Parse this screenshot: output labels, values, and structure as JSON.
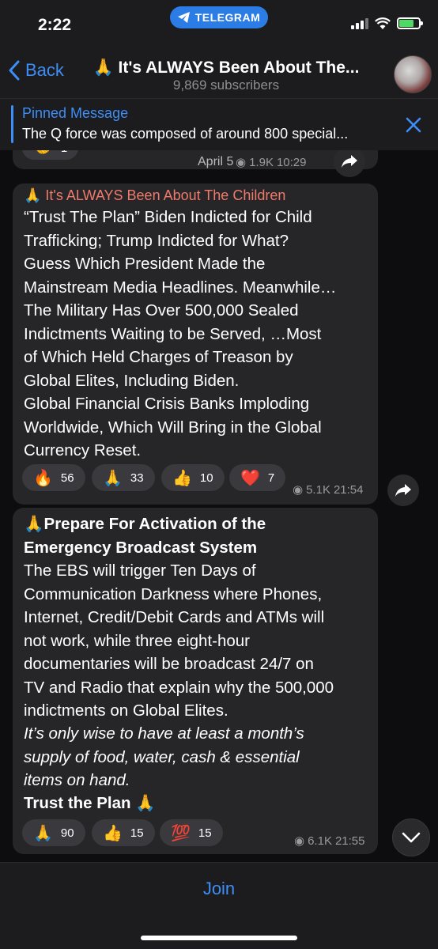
{
  "status_bar": {
    "time": "2:22",
    "telegram_pill": "TELEGRAM"
  },
  "nav": {
    "back_label": "Back",
    "channel_title": "🙏 It's ALWAYS Been About The...",
    "subscribers": "9,869 subscribers"
  },
  "pinned": {
    "label": "Pinned Message",
    "text": "The Q force was composed of around 800 special..."
  },
  "prev_message": {
    "reaction_count": "1",
    "date_chip": "April 5",
    "views": "1.9K",
    "time": "10:29"
  },
  "message1": {
    "sender": "🙏 It's ALWAYS Been About The Children",
    "lines": [
      "“Trust The Plan” Biden Indicted for Child",
      "Trafficking; Trump Indicted for What?",
      "Guess Which President Made the",
      "Mainstream Media Headlines. Meanwhile…",
      "The Military Has Over 500,000 Sealed",
      "Indictments Waiting to be Served, …Most",
      "of Which Held Charges of Treason by",
      "Global Elites, Including Biden.",
      "Global Financial Crisis Banks Imploding",
      "Worldwide, Which Will Bring in the Global",
      "Currency Reset."
    ],
    "reactions": [
      {
        "emoji": "🔥",
        "count": "56"
      },
      {
        "emoji": "🙏",
        "count": "33"
      },
      {
        "emoji": "👍",
        "count": "10"
      },
      {
        "emoji": "❤️",
        "count": "7"
      }
    ],
    "views": "5.1K",
    "time": "21:54"
  },
  "message2": {
    "bold_lines": [
      "🙏Prepare For Activation of the",
      "Emergency Broadcast System"
    ],
    "lines": [
      "The EBS will trigger Ten Days of",
      "Communication Darkness where Phones,",
      "Internet, Credit/Debit Cards and ATMs will",
      "not work, while three eight-hour",
      "documentaries will be broadcast 24/7 on",
      "TV and Radio that explain why the 500,000",
      "indictments on Global Elites."
    ],
    "italic_lines": [
      "It’s only wise to have at least a month’s",
      "supply of food, water, cash & essential",
      "items on hand."
    ],
    "closing": "Trust the Plan 🙏",
    "reactions": [
      {
        "emoji": "🙏",
        "count": "90"
      },
      {
        "emoji": "👍",
        "count": "15"
      },
      {
        "emoji": "💯",
        "count": "15"
      }
    ],
    "views": "6.1K",
    "time": "21:55"
  },
  "footer": {
    "join_label": "Join"
  },
  "colors": {
    "accent": "#3e8ef7",
    "sender_name": "#f07a6b",
    "bubble": "#262628"
  }
}
